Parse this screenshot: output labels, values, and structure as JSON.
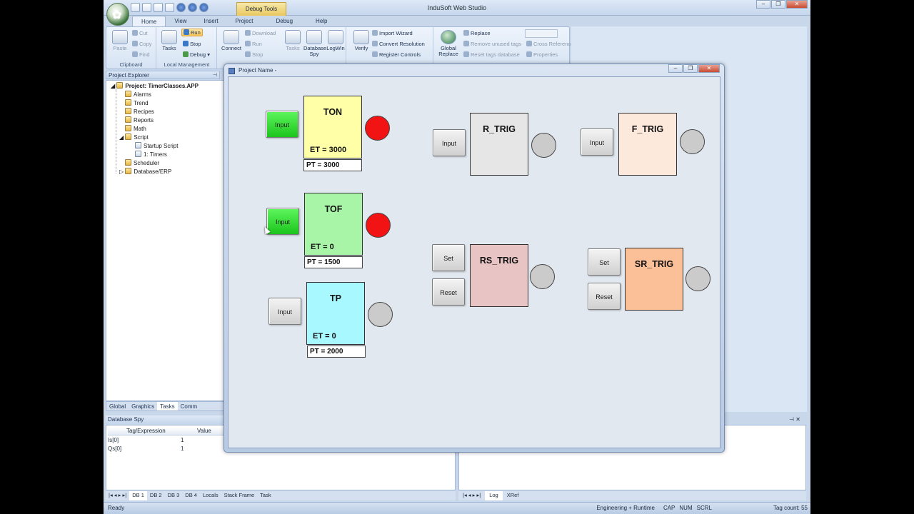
{
  "app": {
    "title": "InduSoft Web Studio",
    "context_tab": "Debug Tools"
  },
  "ribbon": {
    "tabs": [
      "Home",
      "View",
      "Insert",
      "Project",
      "Debug",
      "Help"
    ],
    "clipboard": {
      "paste": "Paste",
      "cut": "Cut",
      "copy": "Copy",
      "find": "Find",
      "label": "Clipboard"
    },
    "local": {
      "tasks": "Tasks",
      "run": "Run",
      "stop": "Stop",
      "debug": "Debug",
      "label": "Local Management"
    },
    "remote": {
      "connect": "Connect",
      "download": "Download",
      "run": "Run",
      "stop": "Stop",
      "tasks": "Tasks",
      "database_spy": "Database Spy",
      "logwin": "LogWin"
    },
    "tools": {
      "verify": "Verify",
      "import_wizard": "Import Wizard",
      "convert_resolution": "Convert Resolution",
      "register_controls": "Register Controls"
    },
    "global": {
      "global_replace": "Global Replace",
      "replace": "Replace",
      "remove_unused": "Remove unused tags",
      "reset_tags": "Reset tags database",
      "cross_reference": "Cross Reference",
      "properties": "Properties"
    }
  },
  "explorer": {
    "title": "Project Explorer",
    "project": "Project: TimerClasses.APP",
    "items": [
      "Alarms",
      "Trend",
      "Recipes",
      "Reports",
      "Math",
      "Script",
      "Startup Script",
      "1: Timers",
      "Scheduler",
      "Database/ERP"
    ],
    "tabs": [
      "Global",
      "Graphics",
      "Tasks",
      "Comm"
    ]
  },
  "runtime": {
    "window_title": "Project Name -",
    "timers": [
      {
        "name": "TON",
        "et": "ET =  3000",
        "pt": "PT = 3000",
        "input": "Input",
        "input_color": "green",
        "lamp": "red",
        "block_color": "#ffffa8"
      },
      {
        "name": "TOF",
        "et": "ET =  0",
        "pt": "PT = 1500",
        "input": "Input",
        "input_color": "green",
        "lamp": "red",
        "block_color": "#a8f5a8"
      },
      {
        "name": "TP",
        "et": "ET =  0",
        "pt": "PT = 2000",
        "input": "Input",
        "input_color": "gray",
        "lamp": "gray",
        "block_color": "#a8f8ff"
      }
    ],
    "triggers": [
      {
        "name": "R_TRIG",
        "buttons": [
          "Input"
        ],
        "block_color": "#e6e6e6"
      },
      {
        "name": "F_TRIG",
        "buttons": [
          "Input"
        ],
        "block_color": "#fde8dc"
      },
      {
        "name": "RS_TRIG",
        "buttons": [
          "Set",
          "Reset"
        ],
        "block_color": "#e9c4c4"
      },
      {
        "name": "SR_TRIG",
        "buttons": [
          "Set",
          "Reset"
        ],
        "block_color": "#fcc099"
      }
    ]
  },
  "database_spy": {
    "title": "Database Spy",
    "columns": [
      "Tag/Expression",
      "Value"
    ],
    "rows": [
      {
        "tag": "Is[0]",
        "value": "1"
      },
      {
        "tag": "Qs[0]",
        "value": "1"
      }
    ],
    "tabs": [
      "DB 1",
      "DB 2",
      "DB 3",
      "DB 4",
      "Locals",
      "Stack Frame",
      "Task"
    ]
  },
  "log": {
    "tabs": [
      "Log",
      "XRef"
    ]
  },
  "status": {
    "left": "Ready",
    "mode": "Engineering + Runtime",
    "caps": "CAP",
    "num": "NUM",
    "scrl": "SCRL",
    "tag_count": "Tag count: 55"
  }
}
